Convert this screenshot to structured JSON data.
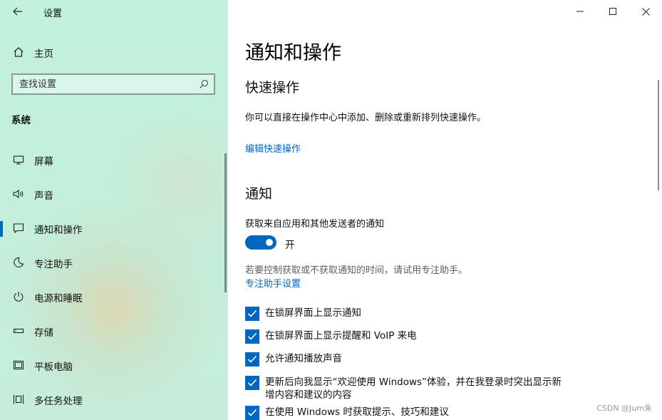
{
  "app": {
    "title": "设置"
  },
  "sidebar": {
    "home_label": "主页",
    "search_placeholder": "查找设置",
    "section_header": "系统",
    "items": [
      {
        "label": "屏幕",
        "icon": "monitor-icon"
      },
      {
        "label": "声音",
        "icon": "speaker-icon"
      },
      {
        "label": "通知和操作",
        "icon": "notification-icon",
        "active": true
      },
      {
        "label": "专注助手",
        "icon": "moon-icon"
      },
      {
        "label": "电源和睡眠",
        "icon": "power-icon"
      },
      {
        "label": "存储",
        "icon": "storage-icon"
      },
      {
        "label": "平板电脑",
        "icon": "tablet-icon"
      },
      {
        "label": "多任务处理",
        "icon": "multitask-icon"
      }
    ]
  },
  "main": {
    "title": "通知和操作",
    "quick_actions": {
      "heading": "快速操作",
      "description": "你可以直接在操作中心中添加、删除或重新排列快速操作。",
      "edit_link": "编辑快速操作"
    },
    "notifications": {
      "heading": "通知",
      "toggle_label": "获取来自应用和其他发送者的通知",
      "toggle_state": "开",
      "toggle_on": true,
      "hint": "若要控制获取或不获取通知的时间，请试用专注助手。",
      "focus_link": "专注助手设置",
      "checkboxes": [
        {
          "label": "在锁屏界面上显示通知",
          "checked": true
        },
        {
          "label": "在锁屏界面上显示提醒和 VoIP 来电",
          "checked": true
        },
        {
          "label": "允许通知播放声音",
          "checked": true
        },
        {
          "label": "更新后向我显示“欢迎使用 Windows”体验，并在我登录时突出显示新增内容和建议的内容",
          "checked": true
        },
        {
          "label": "在使用 Windows 时获取提示、技巧和建议",
          "checked": true
        }
      ]
    }
  },
  "watermark": "CSDN @Jum朱",
  "colors": {
    "accent": "#0067c0",
    "sidebar_bg": "#c2f1dc"
  }
}
